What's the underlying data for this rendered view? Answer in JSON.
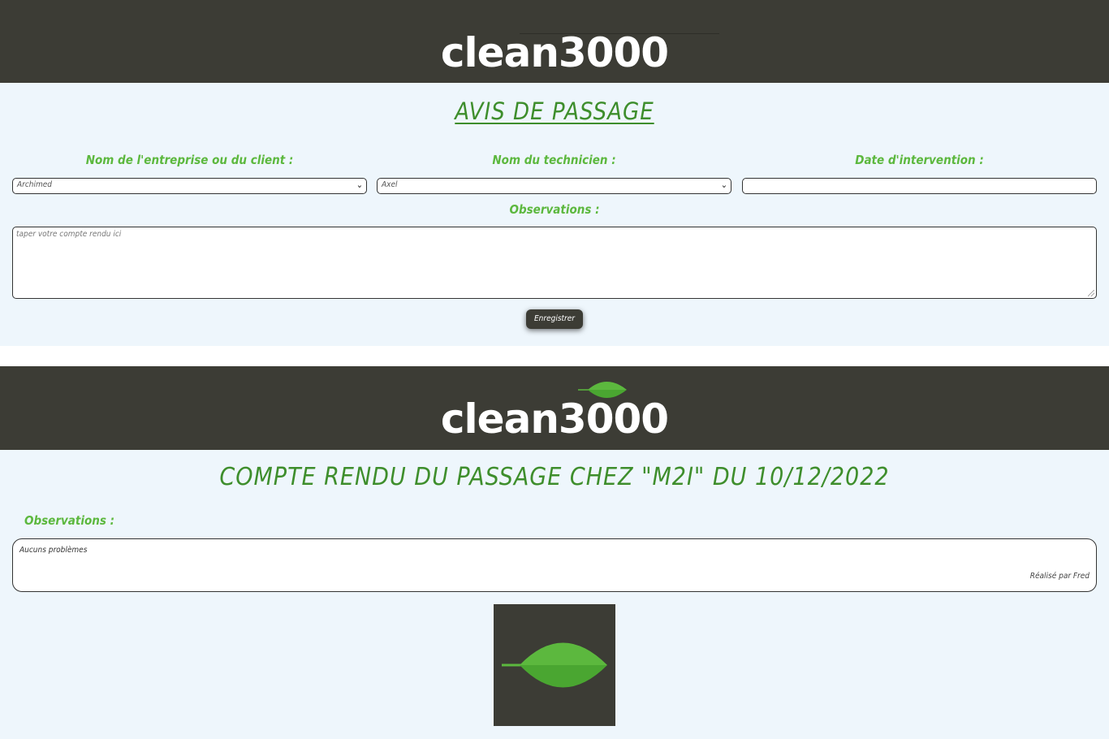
{
  "brand": {
    "name": "clean3000",
    "dark_color": "#3c3c35",
    "green": "#5cb83e",
    "dark_green": "#3e8e2c",
    "panel_bg": "#eef6fc"
  },
  "form": {
    "title": "AVIS DE PASSAGE",
    "client_label": "Nom de l'entreprise ou du client :",
    "client_value": "Archimed",
    "technician_label": "Nom du technicien :",
    "technician_value": "Axel",
    "date_label": "Date d'intervention :",
    "date_value": "",
    "observations_label": "Observations :",
    "observations_placeholder": "taper votre compte rendu ici",
    "submit_label": "Enregistrer"
  },
  "report": {
    "title": "COMPTE RENDU DU PASSAGE CHEZ \"M2I\" DU 10/12/2022",
    "observations_label": "Observations :",
    "text": "Aucuns problèmes",
    "author": "Réalisé par Fred"
  },
  "icons": {
    "logo_leaf": "leaf-icon",
    "select_chevron": "chevron-down-icon"
  }
}
